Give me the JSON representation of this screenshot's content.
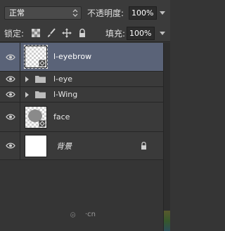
{
  "blend_mode": {
    "value": "正常"
  },
  "opacity": {
    "label": "不透明度:",
    "value": "100%"
  },
  "lock": {
    "label": "锁定:"
  },
  "fill": {
    "label": "填充:",
    "value": "100%"
  },
  "layers": [
    {
      "name": "l-eyebrow",
      "kind": "smart-object",
      "selected": true
    },
    {
      "name": "l-eye",
      "kind": "group"
    },
    {
      "name": "l-Wing",
      "kind": "group"
    },
    {
      "name": "face",
      "kind": "smart-object"
    },
    {
      "name": "背景",
      "kind": "background",
      "locked": true
    }
  ],
  "watermark": {
    "text": "·cn"
  },
  "colors": {
    "selected_row": "#5a6378",
    "panel_bg": "#353535"
  }
}
